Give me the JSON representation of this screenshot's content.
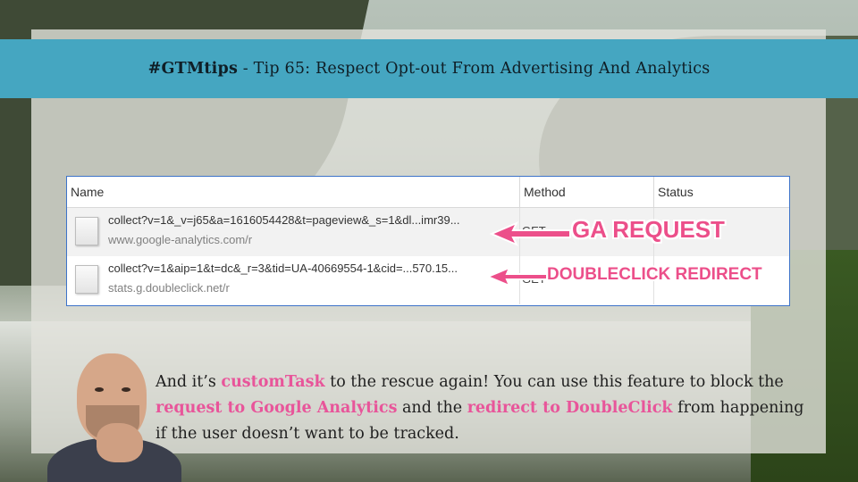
{
  "title_bar": {
    "tag": "#GTMtips",
    "text": " - Tip 65: Respect Opt-out From Advertising And Analytics"
  },
  "network_table": {
    "headers": {
      "name": "Name",
      "method": "Method",
      "status": "Status"
    },
    "rows": [
      {
        "url": "collect?v=1&_v=j65&a=1616054428&t=pageview&_s=1&dl...imr39...",
        "host": "www.google-analytics.com/r",
        "method": "GET"
      },
      {
        "url": "collect?v=1&aip=1&t=dc&_r=3&tid=UA-40669554-1&cid=...570.15...",
        "host": "stats.g.doubleclick.net/r",
        "method": "GET"
      }
    ]
  },
  "annotations": {
    "ga": "GA REQUEST",
    "dc": "DOUBLECLICK REDIRECT",
    "color": "#ec4f8a"
  },
  "description": {
    "p1": "And it’s ",
    "h1": "customTask",
    "p2": " to the rescue again! You can use this feature to block the ",
    "h2": "request to Google Analytics",
    "p3": " and the ",
    "h3": "redirect to DoubleClick",
    "p4": " from happening if the user doesn’t want to be tracked."
  },
  "colors": {
    "title_bar_bg": "#45a6c1",
    "highlight": "#e8559a",
    "table_border": "#3d73c9"
  },
  "icons": {
    "file": "document-icon",
    "arrow": "left-arrow-icon"
  }
}
